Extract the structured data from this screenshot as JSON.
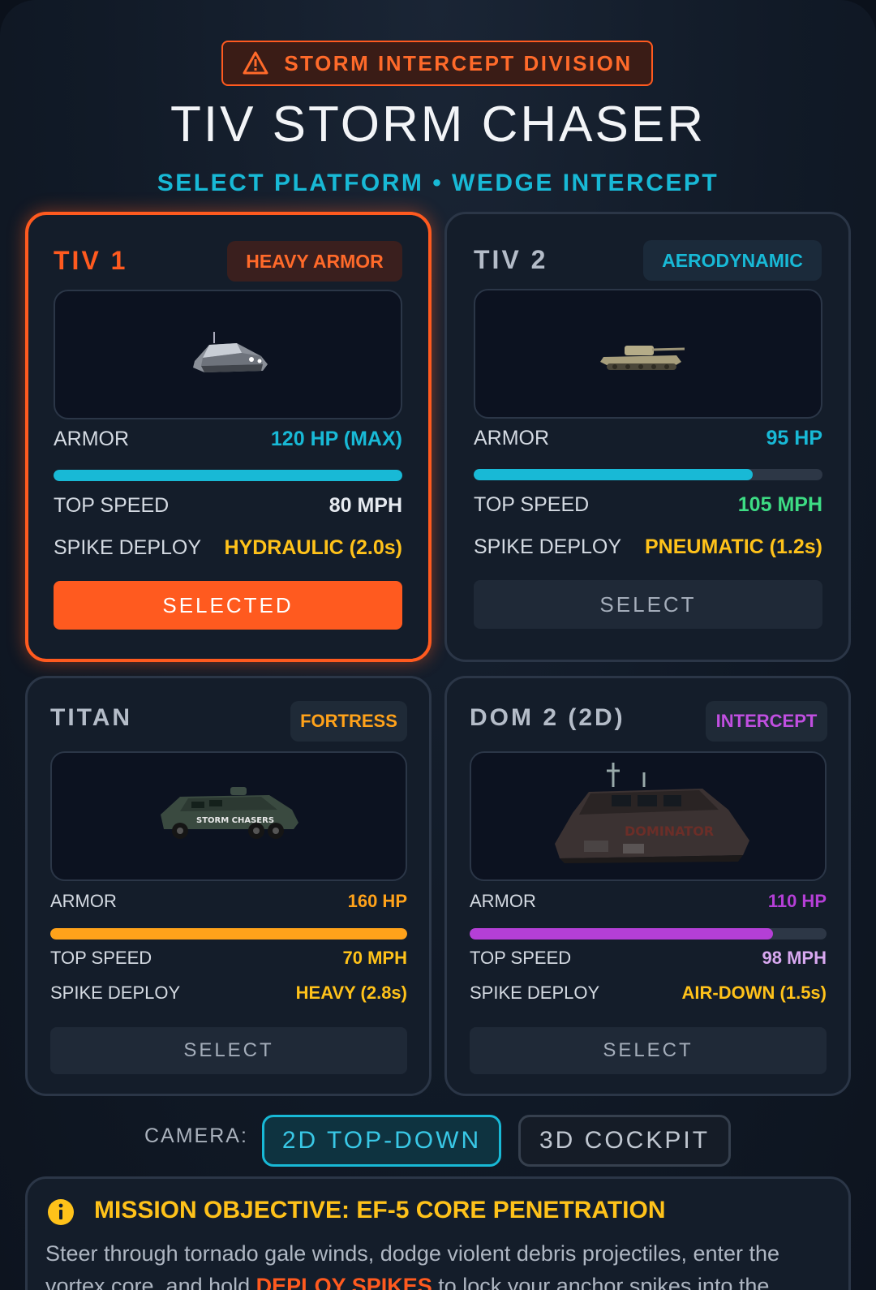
{
  "header": {
    "division": "STORM INTERCEPT DIVISION",
    "division_icon": "warning-triangle-icon",
    "title": "TIV STORM CHASER",
    "subtitle": "SELECT PLATFORM • WEDGE INTERCEPT"
  },
  "colors": {
    "accent_orange": "#ff5a1f",
    "accent_cyan": "#18b9d6",
    "yellow": "#ffc21a",
    "green": "#3ddc84",
    "purple": "#b43fd6",
    "amber": "#ffa21a"
  },
  "labels": {
    "armor": "ARMOR",
    "top_speed": "TOP SPEED",
    "spike_deploy": "SPIKE DEPLOY"
  },
  "vehicles": [
    {
      "name": "TIV 1",
      "tag": "HEAVY ARMOR",
      "armor": "120 HP (MAX)",
      "armor_fraction": 1.0,
      "top_speed": "80 MPH",
      "spike_deploy": "HYDRAULIC (2.0s)",
      "button": "SELECTED",
      "selected": true,
      "image": "tiv1-vehicle-image"
    },
    {
      "name": "TIV 2",
      "tag": "AERODYNAMIC",
      "armor": "95 HP",
      "armor_fraction": 0.8,
      "top_speed": "105 MPH",
      "spike_deploy": "PNEUMATIC (1.2s)",
      "button": "SELECT",
      "selected": false,
      "image": "tiv2-vehicle-image"
    },
    {
      "name": "TITAN",
      "tag": "FORTRESS",
      "armor": "160 HP",
      "armor_fraction": 1.0,
      "top_speed": "70 MPH",
      "spike_deploy": "HEAVY (2.8s)",
      "button": "SELECT",
      "selected": false,
      "image": "titan-vehicle-image",
      "image_text": "STORM CHASERS"
    },
    {
      "name": "DOM 2 (2D)",
      "tag": "INTERCEPT",
      "armor": "110 HP",
      "armor_fraction": 0.85,
      "top_speed": "98 MPH",
      "spike_deploy": "AIR-DOWN (1.5s)",
      "button": "SELECT",
      "selected": false,
      "image": "dom2-vehicle-image",
      "image_text": "DOMINATOR"
    }
  ],
  "camera": {
    "label": "CAMERA:",
    "options": [
      "2D TOP-DOWN",
      "3D COCKPIT"
    ],
    "active": "2D TOP-DOWN"
  },
  "mission": {
    "icon": "info-icon",
    "title": "MISSION OBJECTIVE: EF-5 CORE PENETRATION",
    "text_before": "Steer through tornado gale winds, dodge violent debris projectiles, enter the vortex core, and hold ",
    "highlight": "DEPLOY SPIKES",
    "text_after": " to lock your anchor spikes into the"
  }
}
